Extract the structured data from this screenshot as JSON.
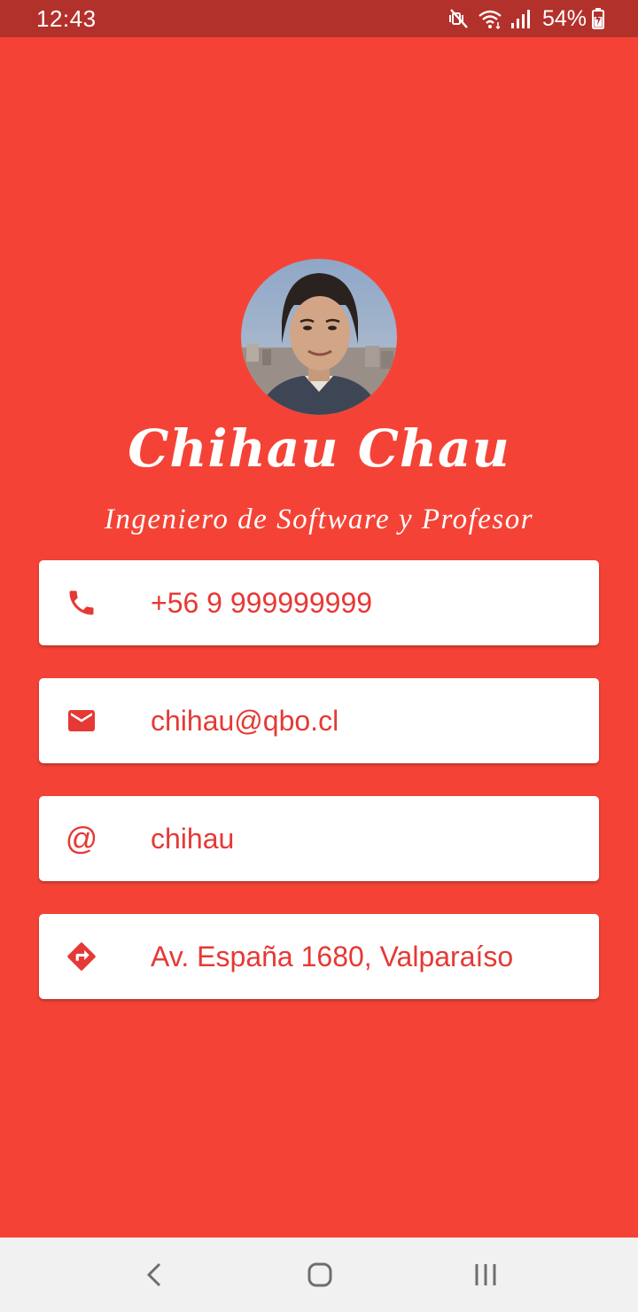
{
  "status_bar": {
    "time": "12:43",
    "battery_percent": "54%",
    "icons": [
      "mute-vibrate-icon",
      "wifi-icon",
      "signal-icon",
      "battery-charging-icon"
    ]
  },
  "profile": {
    "name": "Chihau Chau",
    "title": "Ingeniero de Software y Profesor"
  },
  "contacts": [
    {
      "icon": "phone-icon",
      "value": "+56 9 999999999"
    },
    {
      "icon": "mail-icon",
      "value": "chihau@qbo.cl"
    },
    {
      "icon": "at-icon",
      "value": "chihau"
    },
    {
      "icon": "directions-icon",
      "value": "Av. España 1680, Valparaíso"
    }
  ],
  "nav_bar": {
    "icons": [
      "back-icon",
      "home-icon",
      "recent-apps-icon"
    ]
  },
  "colors": {
    "background": "#f44336",
    "status_bar": "#b3312b",
    "accent": "#e53935",
    "card": "#ffffff",
    "nav_bar": "#f1f1f1"
  }
}
